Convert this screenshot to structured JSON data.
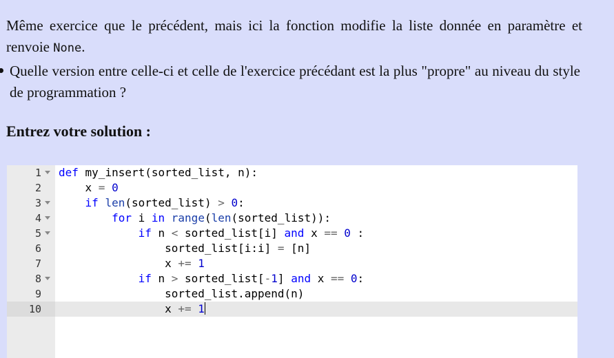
{
  "instructions": {
    "p1_text_before": "Même exercice que le précédent, mais ici la fonction modifie la liste donnée en paramètre et renvoie ",
    "p1_code": "None",
    "p1_text_after": ".",
    "p2_text": "Quelle version entre celle-ci et celle de l'exercice précédant est la plus \"propre\" au niveau du style de programmation ?"
  },
  "heading": "Entrez votre solution :",
  "editor": {
    "active_line": 10,
    "lines": [
      {
        "n": "1",
        "fold": true
      },
      {
        "n": "2",
        "fold": false
      },
      {
        "n": "3",
        "fold": true
      },
      {
        "n": "4",
        "fold": true
      },
      {
        "n": "5",
        "fold": true
      },
      {
        "n": "6",
        "fold": false
      },
      {
        "n": "7",
        "fold": false
      },
      {
        "n": "8",
        "fold": true
      },
      {
        "n": "9",
        "fold": false
      },
      {
        "n": "10",
        "fold": false
      }
    ],
    "code": [
      [
        [
          "kw",
          "def"
        ],
        [
          "t",
          " my_insert(sorted_list, n):"
        ]
      ],
      [
        [
          "t",
          "    x "
        ],
        [
          "op",
          "="
        ],
        [
          "t",
          " "
        ],
        [
          "nm",
          "0"
        ]
      ],
      [
        [
          "t",
          "    "
        ],
        [
          "kw",
          "if"
        ],
        [
          "t",
          " "
        ],
        [
          "fn",
          "len"
        ],
        [
          "t",
          "(sorted_list) "
        ],
        [
          "op",
          ">"
        ],
        [
          "t",
          " "
        ],
        [
          "nm",
          "0"
        ],
        [
          "t",
          ":"
        ]
      ],
      [
        [
          "t",
          "        "
        ],
        [
          "kw",
          "for"
        ],
        [
          "t",
          " i "
        ],
        [
          "kw",
          "in"
        ],
        [
          "t",
          " "
        ],
        [
          "fn",
          "range"
        ],
        [
          "t",
          "("
        ],
        [
          "fn",
          "len"
        ],
        [
          "t",
          "(sorted_list)):"
        ]
      ],
      [
        [
          "t",
          "            "
        ],
        [
          "kw",
          "if"
        ],
        [
          "t",
          " n "
        ],
        [
          "op",
          "<"
        ],
        [
          "t",
          " sorted_list[i] "
        ],
        [
          "kw",
          "and"
        ],
        [
          "t",
          " x "
        ],
        [
          "op",
          "=="
        ],
        [
          "t",
          " "
        ],
        [
          "nm",
          "0"
        ],
        [
          "t",
          " :"
        ]
      ],
      [
        [
          "t",
          "                sorted_list[i:i] "
        ],
        [
          "op",
          "="
        ],
        [
          "t",
          " [n]"
        ]
      ],
      [
        [
          "t",
          "                x "
        ],
        [
          "op",
          "+="
        ],
        [
          "t",
          " "
        ],
        [
          "nm",
          "1"
        ]
      ],
      [
        [
          "t",
          "            "
        ],
        [
          "kw",
          "if"
        ],
        [
          "t",
          " n "
        ],
        [
          "op",
          ">"
        ],
        [
          "t",
          " sorted_list["
        ],
        [
          "op",
          "-"
        ],
        [
          "nm",
          "1"
        ],
        [
          "t",
          "] "
        ],
        [
          "kw",
          "and"
        ],
        [
          "t",
          " x "
        ],
        [
          "op",
          "=="
        ],
        [
          "t",
          " "
        ],
        [
          "nm",
          "0"
        ],
        [
          "t",
          ":"
        ]
      ],
      [
        [
          "t",
          "                sorted_list.append(n)"
        ]
      ],
      [
        [
          "t",
          "                x "
        ],
        [
          "op",
          "+="
        ],
        [
          "t",
          " "
        ],
        [
          "nm",
          "1"
        ]
      ]
    ]
  }
}
